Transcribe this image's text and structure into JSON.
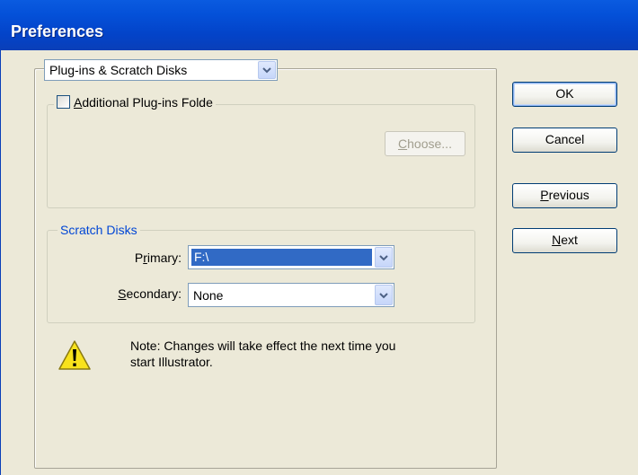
{
  "window": {
    "title": "Preferences"
  },
  "page_selector": {
    "value": "Plug-ins & Scratch Disks"
  },
  "plugins_group": {
    "checkbox_label_mnemonic": "A",
    "checkbox_label_rest": "dditional Plug-ins Folde",
    "checked": false,
    "choose_mnemonic": "C",
    "choose_rest": "hoose..."
  },
  "scratch_group": {
    "legend": "Scratch Disks",
    "primary_pre": "P",
    "primary_mnemonic": "r",
    "primary_post": "imary:",
    "primary_value": "F:\\",
    "secondary_mnemonic": "S",
    "secondary_post": "econdary:",
    "secondary_value": "None"
  },
  "note": {
    "icon": "warning-icon",
    "line1": "Note:  Changes will take effect the next time you",
    "line2": "start Illustrator."
  },
  "buttons": {
    "ok": "OK",
    "cancel": "Cancel",
    "previous_mnemonic": "P",
    "previous_rest": "revious",
    "next_mnemonic": "N",
    "next_rest": "ext"
  },
  "colors": {
    "titlebar": "#0450d8",
    "dialog_bg": "#ece9d8",
    "selection": "#316ac5",
    "group_legend": "#0046d5"
  }
}
